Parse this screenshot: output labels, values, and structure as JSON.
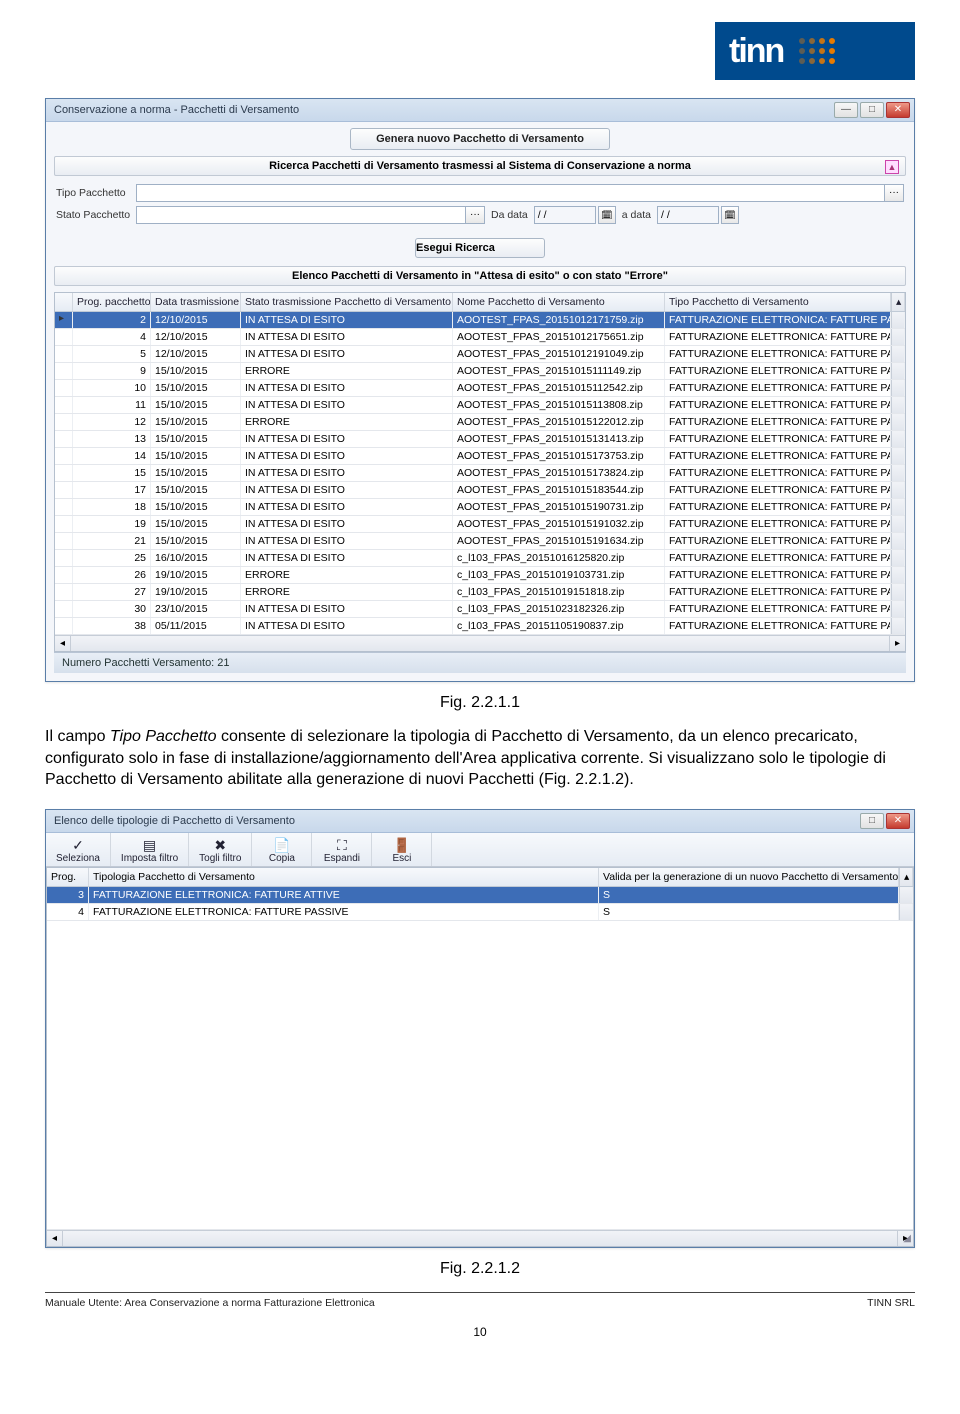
{
  "logo": {
    "text": "tinn"
  },
  "window1": {
    "title": "Conservazione a norma - Pacchetti di Versamento",
    "generate_btn": "Genera nuovo Pacchetto di Versamento",
    "search_banner": "Ricerca Pacchetti di Versamento trasmessi al Sistema di Conservazione a norma",
    "filters": {
      "tipo_label": "Tipo Pacchetto",
      "stato_label": "Stato Pacchetto",
      "tipo_value": "",
      "stato_value": "",
      "da_data_label": "Da data",
      "a_data_label": "a data",
      "da_data_value": "/ /",
      "a_data_value": "/ /"
    },
    "exec_btn": "Esegui Ricerca",
    "list_banner": "Elenco Pacchetti di Versamento in \"Attesa di esito\" o con stato \"Errore\"",
    "columns": [
      "Prog. pacchetto",
      "Data trasmissione",
      "Stato trasmissione Pacchetto di Versamento",
      "Nome Pacchetto di Versamento",
      "Tipo Pacchetto di Versamento"
    ],
    "rows": [
      [
        "2",
        "12/10/2015",
        "IN ATTESA DI ESITO",
        "AOOTEST_FPAS_20151012171759.zip",
        "FATTURAZIONE ELETTRONICA: FATTURE PASSIVE"
      ],
      [
        "4",
        "12/10/2015",
        "IN ATTESA DI ESITO",
        "AOOTEST_FPAS_20151012175651.zip",
        "FATTURAZIONE ELETTRONICA: FATTURE PASSIVE"
      ],
      [
        "5",
        "12/10/2015",
        "IN ATTESA DI ESITO",
        "AOOTEST_FPAS_20151012191049.zip",
        "FATTURAZIONE ELETTRONICA: FATTURE PASSIVE"
      ],
      [
        "9",
        "15/10/2015",
        "ERRORE",
        "AOOTEST_FPAS_20151015111149.zip",
        "FATTURAZIONE ELETTRONICA: FATTURE PASSIVE"
      ],
      [
        "10",
        "15/10/2015",
        "IN ATTESA DI ESITO",
        "AOOTEST_FPAS_20151015112542.zip",
        "FATTURAZIONE ELETTRONICA: FATTURE PASSIVE"
      ],
      [
        "11",
        "15/10/2015",
        "IN ATTESA DI ESITO",
        "AOOTEST_FPAS_20151015113808.zip",
        "FATTURAZIONE ELETTRONICA: FATTURE PASSIVE"
      ],
      [
        "12",
        "15/10/2015",
        "ERRORE",
        "AOOTEST_FPAS_20151015122012.zip",
        "FATTURAZIONE ELETTRONICA: FATTURE PASSIVE"
      ],
      [
        "13",
        "15/10/2015",
        "IN ATTESA DI ESITO",
        "AOOTEST_FPAS_20151015131413.zip",
        "FATTURAZIONE ELETTRONICA: FATTURE PASSIVE"
      ],
      [
        "14",
        "15/10/2015",
        "IN ATTESA DI ESITO",
        "AOOTEST_FPAS_20151015173753.zip",
        "FATTURAZIONE ELETTRONICA: FATTURE PASSIVE"
      ],
      [
        "15",
        "15/10/2015",
        "IN ATTESA DI ESITO",
        "AOOTEST_FPAS_20151015173824.zip",
        "FATTURAZIONE ELETTRONICA: FATTURE PASSIVE"
      ],
      [
        "17",
        "15/10/2015",
        "IN ATTESA DI ESITO",
        "AOOTEST_FPAS_20151015183544.zip",
        "FATTURAZIONE ELETTRONICA: FATTURE PASSIVE"
      ],
      [
        "18",
        "15/10/2015",
        "IN ATTESA DI ESITO",
        "AOOTEST_FPAS_20151015190731.zip",
        "FATTURAZIONE ELETTRONICA: FATTURE PASSIVE"
      ],
      [
        "19",
        "15/10/2015",
        "IN ATTESA DI ESITO",
        "AOOTEST_FPAS_20151015191032.zip",
        "FATTURAZIONE ELETTRONICA: FATTURE PASSIVE"
      ],
      [
        "21",
        "15/10/2015",
        "IN ATTESA DI ESITO",
        "AOOTEST_FPAS_20151015191634.zip",
        "FATTURAZIONE ELETTRONICA: FATTURE PASSIVE"
      ],
      [
        "25",
        "16/10/2015",
        "IN ATTESA DI ESITO",
        "c_l103_FPAS_20151016125820.zip",
        "FATTURAZIONE ELETTRONICA: FATTURE PASSIVE"
      ],
      [
        "26",
        "19/10/2015",
        "ERRORE",
        "c_l103_FPAS_20151019103731.zip",
        "FATTURAZIONE ELETTRONICA: FATTURE PASSIVE"
      ],
      [
        "27",
        "19/10/2015",
        "ERRORE",
        "c_l103_FPAS_20151019151818.zip",
        "FATTURAZIONE ELETTRONICA: FATTURE PASSIVE"
      ],
      [
        "30",
        "23/10/2015",
        "IN ATTESA DI ESITO",
        "c_l103_FPAS_20151023182326.zip",
        "FATTURAZIONE ELETTRONICA: FATTURE PASSIVE"
      ],
      [
        "38",
        "05/11/2015",
        "IN ATTESA DI ESITO",
        "c_l103_FPAS_20151105190837.zip",
        "FATTURAZIONE ELETTRONICA: FATTURE PASSIVE"
      ]
    ],
    "status": "Numero Pacchetti Versamento: 21"
  },
  "fig1": "Fig. 2.2.1.1",
  "paragraph_parts": {
    "p1a": "Il campo ",
    "p1b": "Tipo Pacchetto",
    "p1c": " consente di selezionare la tipologia di Pacchetto di Versamento, da un elenco precaricato, configurato solo in fase di installazione/aggiornamento dell'Area applicativa corrente. Si visualizzano solo le tipologie di Pacchetto di Versamento abilitate alla generazione di nuovi Pacchetti (Fig. 2.2.1.2)."
  },
  "window2": {
    "title": "Elenco delle tipologie di Pacchetto di Versamento",
    "toolbar": [
      {
        "name": "seleziona",
        "label": "Seleziona",
        "icon": "✓"
      },
      {
        "name": "imposta-filtro",
        "label": "Imposta filtro",
        "icon": "▤"
      },
      {
        "name": "togli-filtro",
        "label": "Togli filtro",
        "icon": "✖"
      },
      {
        "name": "copia",
        "label": "Copia",
        "icon": "📄"
      },
      {
        "name": "espandi",
        "label": "Espandi",
        "icon": "⛶"
      },
      {
        "name": "esci",
        "label": "Esci",
        "icon": "🚪"
      }
    ],
    "columns": [
      "Prog.",
      "Tipologia Pacchetto di Versamento",
      "Valida per la generazione di un nuovo Pacchetto di Versamento"
    ],
    "rows": [
      [
        "3",
        "FATTURAZIONE ELETTRONICA: FATTURE ATTIVE",
        "S"
      ],
      [
        "4",
        "FATTURAZIONE ELETTRONICA: FATTURE PASSIVE",
        "S"
      ]
    ]
  },
  "fig2": "Fig. 2.2.1.2",
  "footer": {
    "left": "Manuale Utente: Area Conservazione a norma Fatturazione Elettronica",
    "right": "TINN SRL",
    "page": "10"
  }
}
